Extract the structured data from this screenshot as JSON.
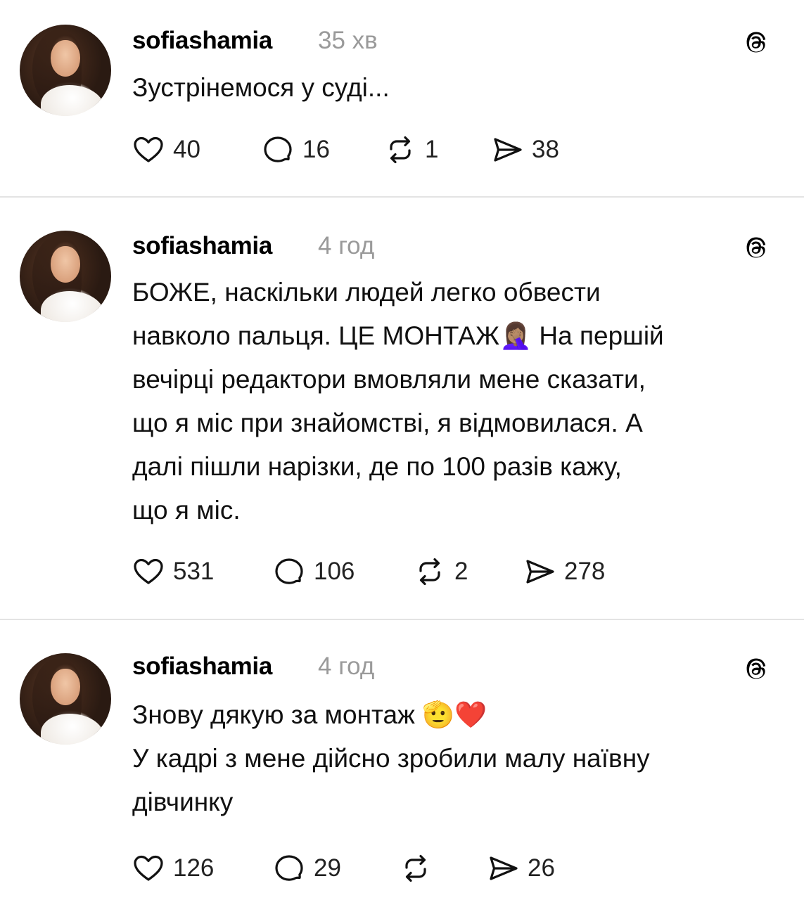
{
  "posts": [
    {
      "username": "sofiashamia",
      "time": "35 хв",
      "text": "Зустрінемося у суді...",
      "likes": "40",
      "replies": "16",
      "reposts": "1",
      "shares": "38"
    },
    {
      "username": "sofiashamia",
      "time": "4 год",
      "text": "БОЖЕ, наскільки людей легко обвести\nнавколо пальця. ЦЕ МОНТАЖ🤦🏽‍♀️ На першій\nвечірці редактори вмовляли мене сказати,\nщо я міс при знайомстві, я відмовилася. А\nдалі пішли нарізки, де по 100 разів кажу,\nщо я міс.",
      "likes": "531",
      "replies": "106",
      "reposts": "2",
      "shares": "278"
    },
    {
      "username": "sofiashamia",
      "time": "4 год",
      "text": "Знову дякую за монтаж 🫡❤️\nУ кадрі з мене дійсно зробили малу наївну\nдівчинку",
      "likes": "126",
      "replies": "29",
      "reposts": "",
      "shares": "26"
    }
  ]
}
